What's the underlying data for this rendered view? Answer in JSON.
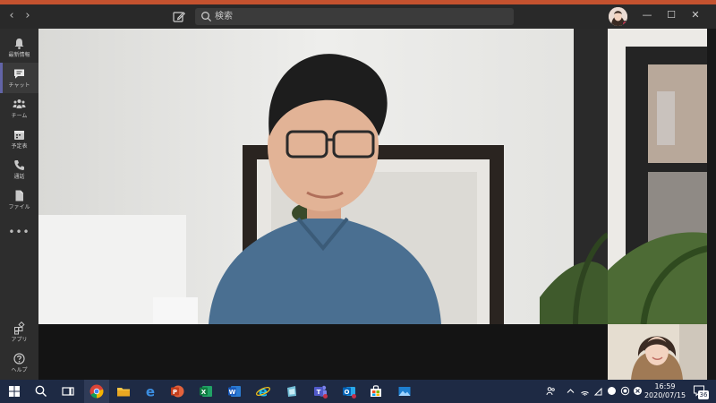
{
  "titlebar": {
    "search_placeholder": "検索",
    "icons": [
      "back-arrow-icon",
      "forward-arrow-icon",
      "compose-icon",
      "search-icon",
      "minimize-icon",
      "maximize-icon",
      "close-icon"
    ]
  },
  "rail": {
    "items": [
      {
        "label": "最新情報",
        "icon": "bell-icon",
        "active": false
      },
      {
        "label": "チャット",
        "icon": "chat-icon",
        "active": true
      },
      {
        "label": "チーム",
        "icon": "teams-icon",
        "active": false
      },
      {
        "label": "予定表",
        "icon": "calendar-icon",
        "active": false
      },
      {
        "label": "通話",
        "icon": "phone-icon",
        "active": false
      },
      {
        "label": "ファイル",
        "icon": "file-icon",
        "active": false
      }
    ],
    "more": "•••",
    "bottom_items": [
      {
        "label": "アプリ",
        "icon": "apps-icon"
      },
      {
        "label": "ヘルプ",
        "icon": "help-icon"
      }
    ]
  },
  "taskbar": {
    "time": "16:59",
    "date": "2020/07/15",
    "notification_count": "36",
    "apps": [
      "windows-start-icon",
      "search-icon",
      "task-view-icon",
      "chrome-icon",
      "file-explorer-icon",
      "edge-icon",
      "powerpoint-icon",
      "excel-icon",
      "word-icon",
      "internet-explorer-icon",
      "app-icon",
      "teams-icon",
      "outlook-icon",
      "store-icon",
      "photos-icon"
    ]
  },
  "colors": {
    "accent": "#6264a7",
    "titlebar": "#292929",
    "rail": "#2d2d2d",
    "taskbar": "#1e2a44",
    "top_strip": "#c4522f"
  }
}
